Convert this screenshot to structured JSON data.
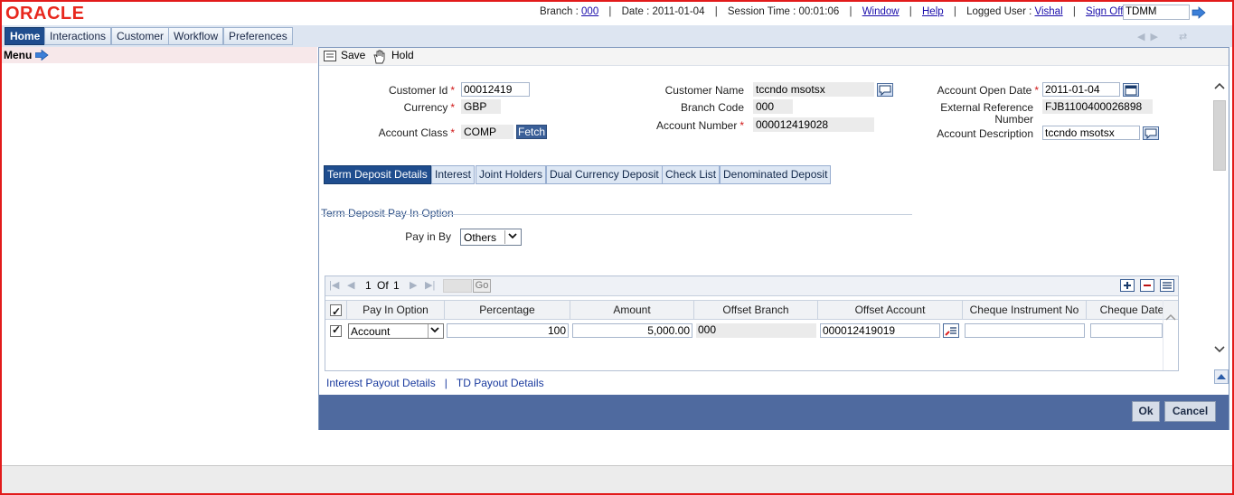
{
  "header": {
    "logo": "ORACLE",
    "branch_label": "Branch :",
    "branch_value": "000",
    "date_text": "Date : 2011-01-04",
    "session_text": "Session Time : 00:01:06",
    "window_link": "Window",
    "help_link": "Help",
    "logged_user_label": "Logged User :",
    "logged_user_value": "Vishal",
    "signoff_link": "Sign Off",
    "site_code_value": "TDMM"
  },
  "nav": {
    "tabs": [
      "Home",
      "Interactions",
      "Customer",
      "Workflow",
      "Preferences"
    ]
  },
  "menu": {
    "label": "Menu"
  },
  "toolbar": {
    "save_label": "Save",
    "hold_label": "Hold"
  },
  "form": {
    "customer_id_label": "Customer Id",
    "customer_id_value": "00012419",
    "currency_label": "Currency",
    "currency_value": "GBP",
    "account_class_label": "Account Class",
    "account_class_value": "COMP",
    "fetch_label": "Fetch",
    "customer_name_label": "Customer Name",
    "customer_name_value": "tccndo msotsx",
    "branch_code_label": "Branch Code",
    "branch_code_value": "000",
    "account_number_label": "Account Number",
    "account_number_value": "000012419028",
    "account_open_date_label": "Account Open Date",
    "account_open_date_value": "2011-01-04",
    "external_ref_label_1": "External Reference",
    "external_ref_label_2": "Number",
    "external_ref_value": "FJB1100400026898",
    "account_desc_label": "Account Description",
    "account_desc_value": "tccndo msotsx"
  },
  "tabs": [
    "Term Deposit Details",
    "Interest",
    "Joint Holders",
    "Dual Currency Deposit",
    "Check List",
    "Denominated Deposit"
  ],
  "section": {
    "title": "Term Deposit Pay In Option",
    "pay_in_by_label": "Pay in By",
    "pay_in_by_value": "Others"
  },
  "grid": {
    "page_current": "1",
    "page_of": "Of",
    "page_total": "1",
    "go_label": "Go",
    "columns": [
      "Pay In Option",
      "Percentage",
      "Amount",
      "Offset Branch",
      "Offset Account",
      "Cheque Instrument No",
      "Cheque Date"
    ],
    "rows": [
      {
        "pay_in_option": "Account",
        "percentage": "100",
        "amount": "5,000.00",
        "offset_branch": "000",
        "offset_account": "000012419019",
        "cheque_instrument_no": "",
        "cheque_date": ""
      }
    ]
  },
  "links": {
    "interest_payout": "Interest Payout Details",
    "separator": "|",
    "td_payout": "TD Payout Details"
  },
  "footer": {
    "ok_label": "Ok",
    "cancel_label": "Cancel"
  }
}
